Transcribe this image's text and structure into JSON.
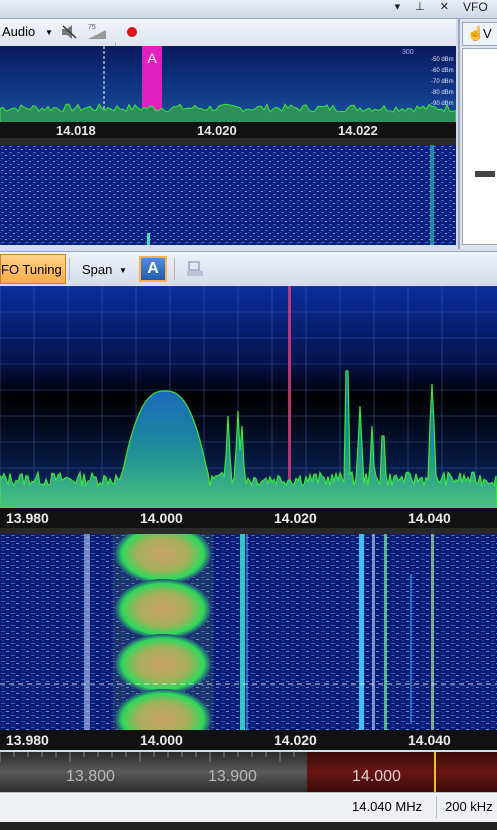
{
  "window": {
    "vfo_panel_title": "VFO",
    "controls": "▾ ⊥ ✕"
  },
  "audio_toolbar": {
    "audio_label": "Audio"
  },
  "top_spectrum": {
    "marker_label": "A",
    "top_value": "300",
    "dbm_labels": [
      "-50 dBm",
      "-60 dBm",
      "-70 dBm",
      "-80 dBm",
      "-90 dBm"
    ],
    "ticks": [
      "14.018",
      "14.020",
      "14.022"
    ]
  },
  "vfo_panel": {
    "tab_label": "V"
  },
  "main_toolbar": {
    "vfo_tuning_label": "FO Tuning",
    "span_label": "Span",
    "a_label": "A"
  },
  "main_spectrum": {
    "ticks": [
      "13.980",
      "14.000",
      "14.020",
      "14.040"
    ]
  },
  "waterfall": {
    "ticks": [
      "13.980",
      "14.000",
      "14.020",
      "14.040"
    ]
  },
  "band_ruler": {
    "labels": [
      "13.800",
      "13.900",
      "14.000"
    ]
  },
  "status": {
    "frequency": "14.040 MHz",
    "bandwidth": "200 kHz"
  },
  "colors": {
    "accent_orange": "#ffac45",
    "spectrum_trace": "#39e83a",
    "marker_magenta": "#e020c0",
    "record_red": "#e0101a"
  }
}
